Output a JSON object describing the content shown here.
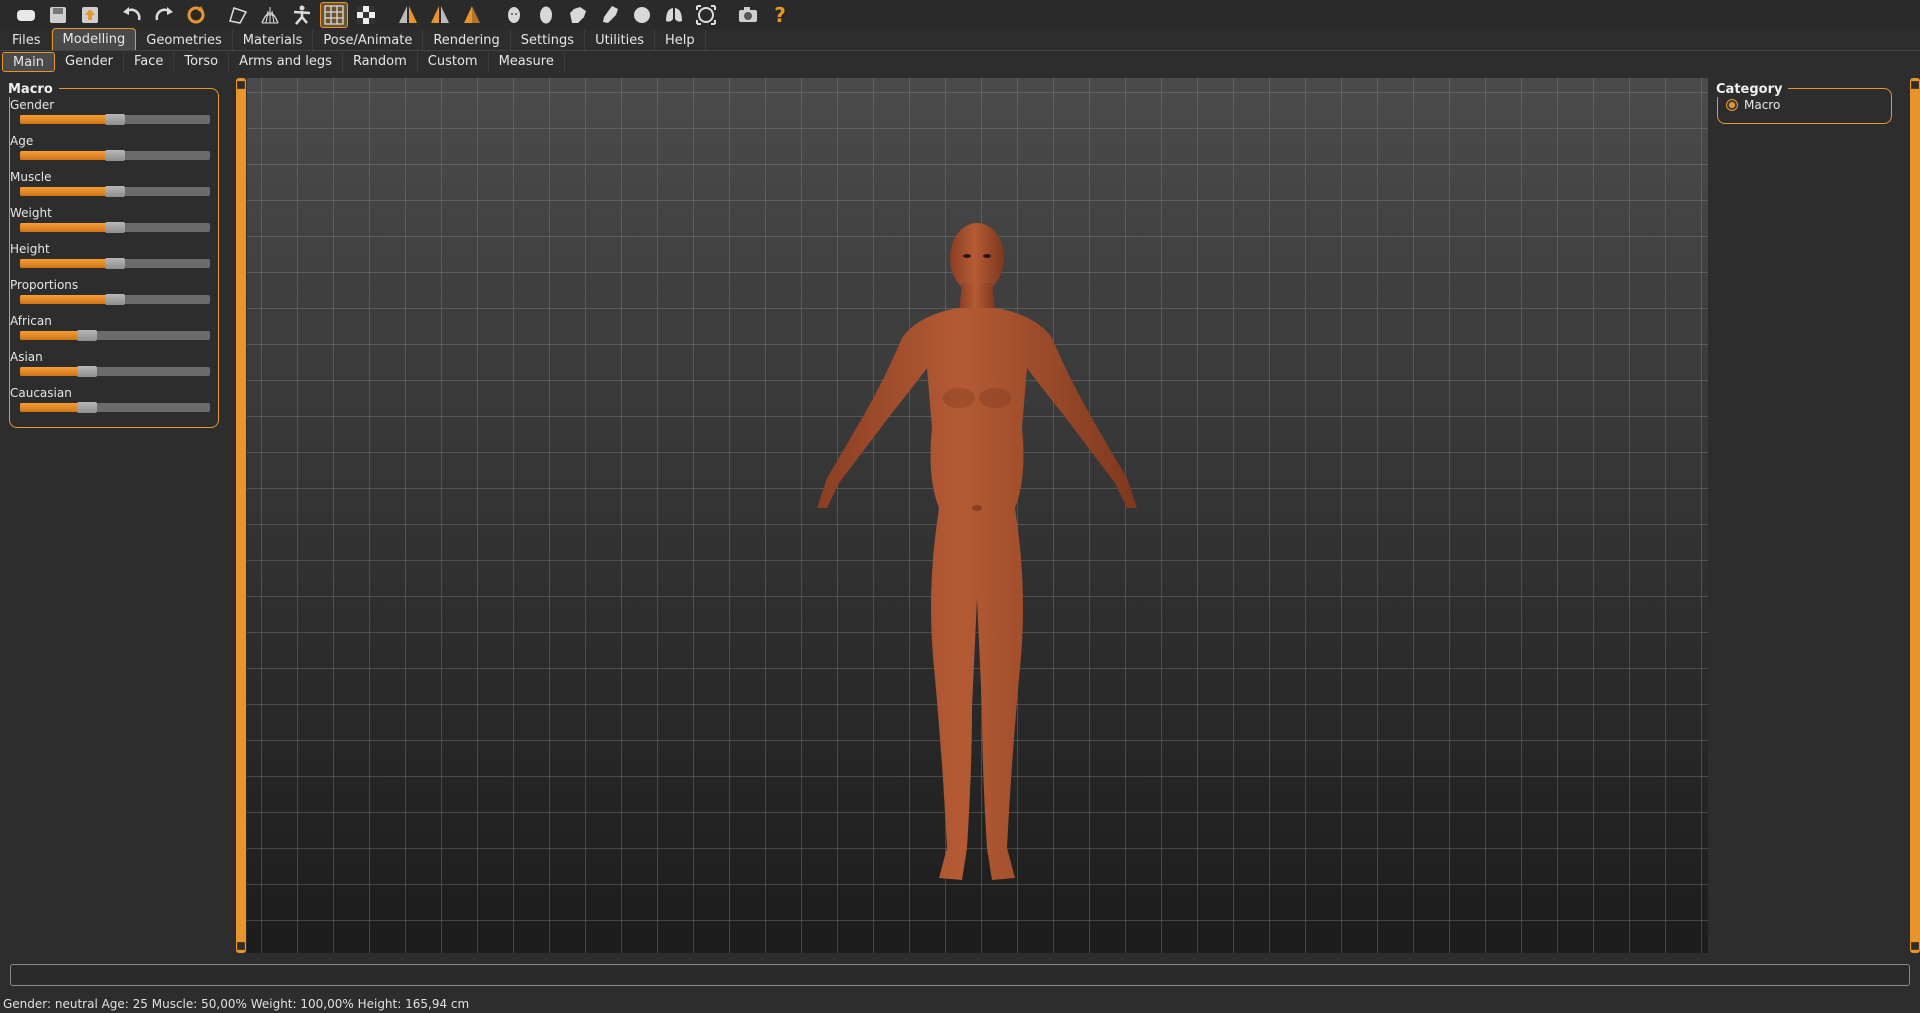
{
  "toolbar": {
    "icons": [
      "new-icon",
      "save-icon",
      "export-icon",
      "undo-icon",
      "redo-icon",
      "reset-icon",
      "smooth-icon",
      "wireframe-icon",
      "pose-icon",
      "grid-icon",
      "checker-icon",
      "front-view-icon",
      "back-view-icon",
      "side-view-icon",
      "head-icon",
      "egg-icon",
      "hand-icon",
      "foot-icon",
      "sphere-icon",
      "lungs-icon",
      "frame-icon",
      "screenshot-icon",
      "help-icon"
    ]
  },
  "main_tabs": [
    "Files",
    "Modelling",
    "Geometries",
    "Materials",
    "Pose/Animate",
    "Rendering",
    "Settings",
    "Utilities",
    "Help"
  ],
  "sub_tabs": [
    "Main",
    "Gender",
    "Face",
    "Torso",
    "Arms and legs",
    "Random",
    "Custom",
    "Measure"
  ],
  "macro": {
    "title": "Macro",
    "sliders": [
      {
        "label": "Gender",
        "value": 0.5
      },
      {
        "label": "Age",
        "value": 0.5
      },
      {
        "label": "Muscle",
        "value": 0.5
      },
      {
        "label": "Weight",
        "value": 0.5
      },
      {
        "label": "Height",
        "value": 0.5
      },
      {
        "label": "Proportions",
        "value": 0.5
      },
      {
        "label": "African",
        "value": 0.333
      },
      {
        "label": "Asian",
        "value": 0.333
      },
      {
        "label": "Caucasian",
        "value": 0.333
      }
    ]
  },
  "category": {
    "title": "Category",
    "option": "Macro"
  },
  "colors": {
    "accent": "#e8962b",
    "skin": "#a9502c"
  },
  "status": "Gender: neutral Age: 25 Muscle: 50,00% Weight: 100,00% Height: 165,94 cm"
}
